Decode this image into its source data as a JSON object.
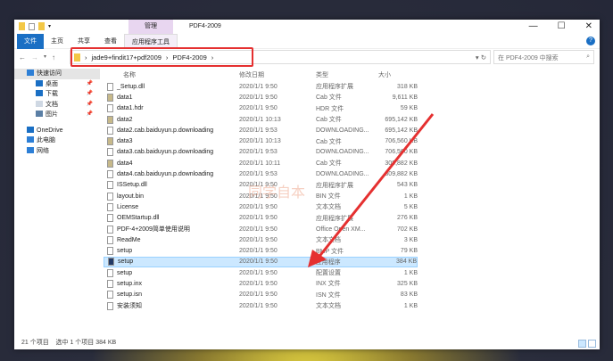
{
  "window": {
    "title": "PDF4-2009",
    "context_tab": "管理",
    "controls": {
      "minimize": "—",
      "maximize": "☐",
      "close": "✕"
    }
  },
  "ribbon": {
    "tabs": [
      "文件",
      "主页",
      "共享",
      "查看",
      "应用程序工具"
    ],
    "help": "?"
  },
  "address": {
    "crumbs": [
      "jade9+findit17+pdf2009",
      "PDF4-2009"
    ],
    "search_placeholder": "在 PDF4-2009 中搜索"
  },
  "sidebar": [
    {
      "label": "快速访问",
      "sub": false,
      "pin": false,
      "sel": true,
      "color": "#2d7fd6"
    },
    {
      "label": "桌面",
      "sub": true,
      "pin": true,
      "color": "#1a6fc4"
    },
    {
      "label": "下载",
      "sub": true,
      "pin": true,
      "color": "#1a6fc4"
    },
    {
      "label": "文档",
      "sub": true,
      "pin": true,
      "color": "#cfd8e3"
    },
    {
      "label": "图片",
      "sub": true,
      "pin": true,
      "color": "#5b7fa5"
    },
    {
      "label": "OneDrive",
      "sub": false,
      "pin": false,
      "color": "#1a6fc4"
    },
    {
      "label": "此电脑",
      "sub": false,
      "pin": false,
      "color": "#2d7fd6"
    },
    {
      "label": "网络",
      "sub": false,
      "pin": false,
      "color": "#2d7fd6"
    }
  ],
  "columns": [
    "名称",
    "修改日期",
    "类型",
    "大小"
  ],
  "files": [
    {
      "name": "_Setup.dll",
      "date": "2020/1/1 9:50",
      "type": "应用程序扩展",
      "size": "318 KB",
      "icon": "dll"
    },
    {
      "name": "data1",
      "date": "2020/1/1 9:50",
      "type": "Cab 文件",
      "size": "9,611 KB",
      "icon": "cab"
    },
    {
      "name": "data1.hdr",
      "date": "2020/1/1 9:50",
      "type": "HDR 文件",
      "size": "59 KB",
      "icon": "file"
    },
    {
      "name": "data2",
      "date": "2020/1/1 10:13",
      "type": "Cab 文件",
      "size": "695,142 KB",
      "icon": "cab"
    },
    {
      "name": "data2.cab.baiduyun.p.downloading",
      "date": "2020/1/1 9:53",
      "type": "DOWNLOADING...",
      "size": "695,142 KB",
      "icon": "file"
    },
    {
      "name": "data3",
      "date": "2020/1/1 10:13",
      "type": "Cab 文件",
      "size": "706,560 KB",
      "icon": "cab"
    },
    {
      "name": "data3.cab.baiduyun.p.downloading",
      "date": "2020/1/1 9:53",
      "type": "DOWNLOADING...",
      "size": "706,560 KB",
      "icon": "file"
    },
    {
      "name": "data4",
      "date": "2020/1/1 10:11",
      "type": "Cab 文件",
      "size": "309,882 KB",
      "icon": "cab"
    },
    {
      "name": "data4.cab.baiduyun.p.downloading",
      "date": "2020/1/1 9:53",
      "type": "DOWNLOADING...",
      "size": "309,882 KB",
      "icon": "file"
    },
    {
      "name": "ISSetup.dll",
      "date": "2020/1/1 9:50",
      "type": "应用程序扩展",
      "size": "543 KB",
      "icon": "dll"
    },
    {
      "name": "layout.bin",
      "date": "2020/1/1 9:50",
      "type": "BIN 文件",
      "size": "1 KB",
      "icon": "file"
    },
    {
      "name": "License",
      "date": "2020/1/1 9:50",
      "type": "文本文档",
      "size": "5 KB",
      "icon": "file"
    },
    {
      "name": "OEMStartup.dll",
      "date": "2020/1/1 9:50",
      "type": "应用程序扩展",
      "size": "276 KB",
      "icon": "dll"
    },
    {
      "name": "PDF-4+2009简单使用说明",
      "date": "2020/1/1 9:50",
      "type": "Office Open XM...",
      "size": "702 KB",
      "icon": "file"
    },
    {
      "name": "ReadMe",
      "date": "2020/1/1 9:50",
      "type": "文本文档",
      "size": "3 KB",
      "icon": "file"
    },
    {
      "name": "setup",
      "date": "2020/1/1 9:50",
      "type": "BMP 文件",
      "size": "79 KB",
      "icon": "file"
    },
    {
      "name": "setup",
      "date": "2020/1/1 9:50",
      "type": "应用程序",
      "size": "384 KB",
      "icon": "exe",
      "selected": true
    },
    {
      "name": "setup",
      "date": "2020/1/1 9:50",
      "type": "配置设置",
      "size": "1 KB",
      "icon": "file"
    },
    {
      "name": "setup.inx",
      "date": "2020/1/1 9:50",
      "type": "INX 文件",
      "size": "325 KB",
      "icon": "file"
    },
    {
      "name": "setup.isn",
      "date": "2020/1/1 9:50",
      "type": "ISN 文件",
      "size": "83 KB",
      "icon": "file"
    },
    {
      "name": "安装须知",
      "date": "2020/1/1 9:50",
      "type": "文本文档",
      "size": "1 KB",
      "icon": "file"
    }
  ],
  "status": {
    "count": "21 个项目",
    "selected": "选中 1 个项目  384 KB"
  },
  "watermark": "同学自本",
  "colors": {
    "highlight": "#e53030",
    "selection": "#cce8ff",
    "accent": "#1a6fc4"
  }
}
